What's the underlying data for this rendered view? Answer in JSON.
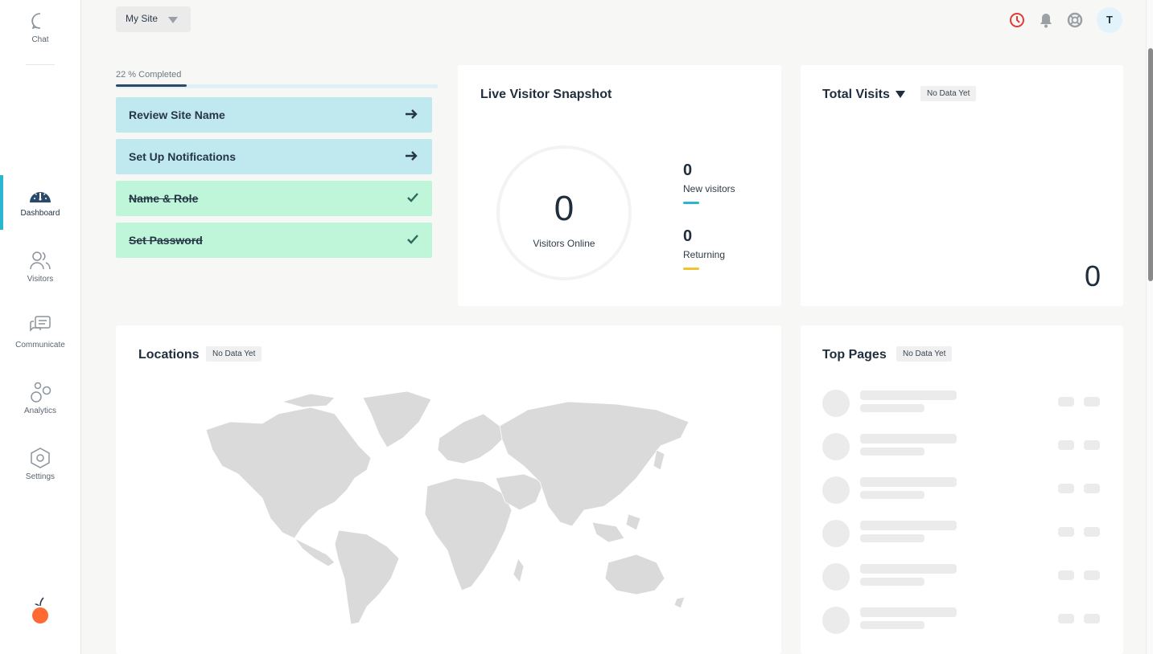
{
  "sidebar": {
    "items": [
      {
        "label": "Chat",
        "icon": "chat-bubble-icon"
      },
      {
        "label": "Dashboard",
        "icon": "dashboard-gauge-icon",
        "active": true
      },
      {
        "label": "Visitors",
        "icon": "visitors-people-icon"
      },
      {
        "label": "Communicate",
        "icon": "communicate-messages-icon"
      },
      {
        "label": "Analytics",
        "icon": "analytics-circles-icon"
      },
      {
        "label": "Settings",
        "icon": "settings-hexagon-icon"
      }
    ],
    "logo_icon": "orange-fruit-logo"
  },
  "header": {
    "site_select": "My Site",
    "avatar_initial": "T",
    "icons": [
      "clock-icon",
      "bell-icon",
      "help-lifebuoy-icon"
    ]
  },
  "onboarding": {
    "progress_label": "22 % Completed",
    "progress_fraction": 0.22,
    "tasks": [
      {
        "label": "Review Site Name",
        "status": "todo"
      },
      {
        "label": "Set Up Notifications",
        "status": "todo"
      },
      {
        "label": "Name & Role",
        "status": "done"
      },
      {
        "label": "Set Password",
        "status": "done"
      }
    ]
  },
  "live_snapshot": {
    "title": "Live Visitor Snapshot",
    "visitors_online": "0",
    "visitors_online_label": "Visitors Online",
    "new_visitors": "0",
    "new_visitors_label": "New visitors",
    "returning": "0",
    "returning_label": "Returning"
  },
  "total_visits": {
    "title": "Total Visits",
    "badge": "No Data Yet",
    "value": "0"
  },
  "locations": {
    "title": "Locations",
    "badge": "No Data Yet"
  },
  "top_pages": {
    "title": "Top Pages",
    "badge": "No Data Yet"
  },
  "colors": {
    "accent": "#29b6d1",
    "returning": "#f2c230",
    "alert": "#e53935",
    "todo_bg": "#bfe8ef",
    "done_bg": "#bff5d8"
  }
}
